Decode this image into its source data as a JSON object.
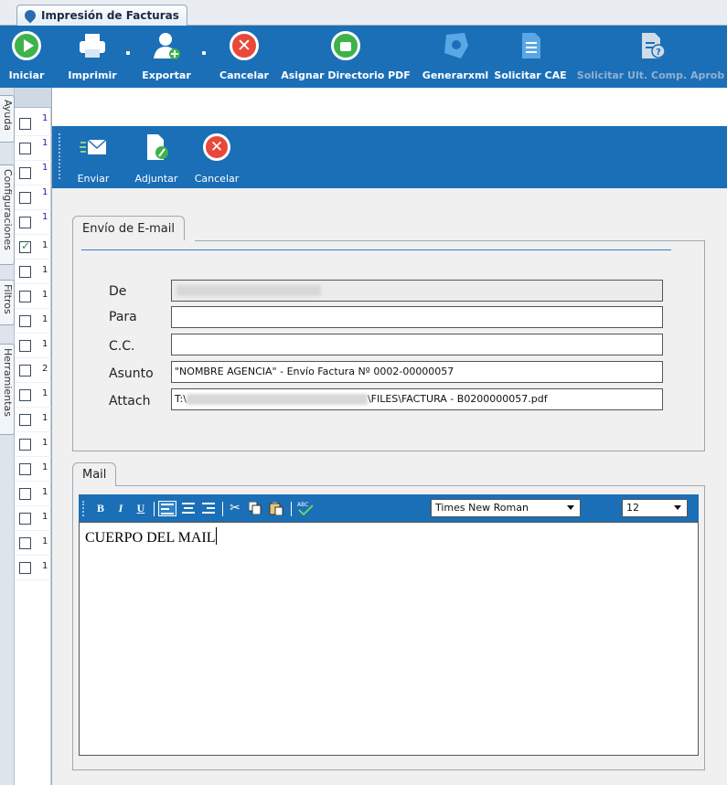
{
  "window": {
    "tab_title": "Impresión de Facturas"
  },
  "ribbon": {
    "buttons": [
      {
        "label": "Iniciar",
        "icon": "play-circle-icon"
      },
      {
        "label": "Imprimir",
        "icon": "printer-icon"
      },
      {
        "label": "Exportar",
        "icon": "export-user-icon"
      },
      {
        "label": "Cancelar",
        "icon": "cancel-circle-icon"
      },
      {
        "label": "Asignar Directorio PDF",
        "icon": "folder-thumb-icon"
      },
      {
        "label": "Generarxml",
        "icon": "xml-shape-icon"
      },
      {
        "label": "Solicitar CAE",
        "icon": "document-list-icon"
      },
      {
        "label": "Solicitar Ult. Comp. Aprob",
        "icon": "document-question-icon",
        "disabled": true
      }
    ]
  },
  "side_tabs": [
    "Ayuda",
    "Configuraciones",
    "Filtros",
    "Herramientas"
  ],
  "grid_rows": [
    {
      "checked": false,
      "num": "1",
      "blue": true
    },
    {
      "checked": false,
      "num": "1",
      "blue": true
    },
    {
      "checked": false,
      "num": "1",
      "blue": true
    },
    {
      "checked": false,
      "num": "1",
      "blue": true
    },
    {
      "checked": false,
      "num": "1",
      "blue": true
    },
    {
      "checked": true,
      "num": "1",
      "blue": false
    },
    {
      "checked": false,
      "num": "1",
      "blue": false
    },
    {
      "checked": false,
      "num": "1",
      "blue": false
    },
    {
      "checked": false,
      "num": "1",
      "blue": false
    },
    {
      "checked": false,
      "num": "1",
      "blue": false
    },
    {
      "checked": false,
      "num": "2",
      "blue": false
    },
    {
      "checked": false,
      "num": "1",
      "blue": false
    },
    {
      "checked": false,
      "num": "1",
      "blue": false
    },
    {
      "checked": false,
      "num": "1",
      "blue": false
    },
    {
      "checked": false,
      "num": "1",
      "blue": false
    },
    {
      "checked": false,
      "num": "1",
      "blue": false
    },
    {
      "checked": false,
      "num": "1",
      "blue": false
    },
    {
      "checked": false,
      "num": "1",
      "blue": false
    },
    {
      "checked": false,
      "num": "1",
      "blue": false
    }
  ],
  "dialog": {
    "toolbar": {
      "send_label": "Enviar",
      "attach_label": "Adjuntar",
      "cancel_label": "Cancelar"
    },
    "email_group": {
      "title": "Envío de E-mail",
      "from_label": "De",
      "from_value": "",
      "to_label": "Para",
      "to_value": "",
      "cc_label": "C.C.",
      "cc_value": "",
      "subject_label": "Asunto",
      "subject_value": "\"NOMBRE AGENCIA\" - Envío Factura Nº 0002-00000057",
      "attach_label": "Attach",
      "attach_prefix": "T:\\",
      "attach_suffix": "\\FILES\\FACTURA - B0200000057.pdf"
    },
    "mail_group": {
      "title": "Mail",
      "toolbar": {
        "bold": "B",
        "italic": "I",
        "underline": "U",
        "font": "Times New Roman",
        "size": "12"
      },
      "body": "CUERPO DEL MAIL"
    }
  },
  "colors": {
    "ribbon_blue": "#1b6fb6",
    "ok_green": "#3fb24a",
    "cancel_red": "#e8493b"
  }
}
